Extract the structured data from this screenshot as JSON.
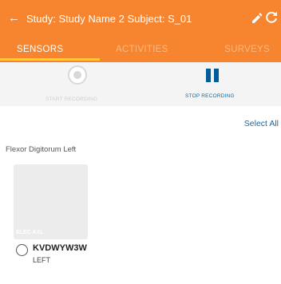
{
  "appbar": {
    "back_glyph": "←",
    "title": "Study: Study Name 2  Subject: S_01",
    "edit_icon": "pencil-icon",
    "refresh_icon": "refresh-icon",
    "background": "#f7842e"
  },
  "tabs": [
    {
      "label": "SENSORS",
      "active": true
    },
    {
      "label": "ACTIVITIES",
      "active": false
    },
    {
      "label": "SURVEYS",
      "active": false
    }
  ],
  "tab_indicator_color": "#ffd11a",
  "controls": {
    "start_label": "START RECORDING",
    "start_enabled": false,
    "stop_label": "STOP RECORDING",
    "stop_enabled": true,
    "stop_color": "#005d9a"
  },
  "select_all": "Select All",
  "muscle_label": "Flexor Digitorum Left",
  "sensor": {
    "type": "ELEC AXL",
    "name": "KVDWYW3W",
    "side": "LEFT",
    "selected": false
  }
}
